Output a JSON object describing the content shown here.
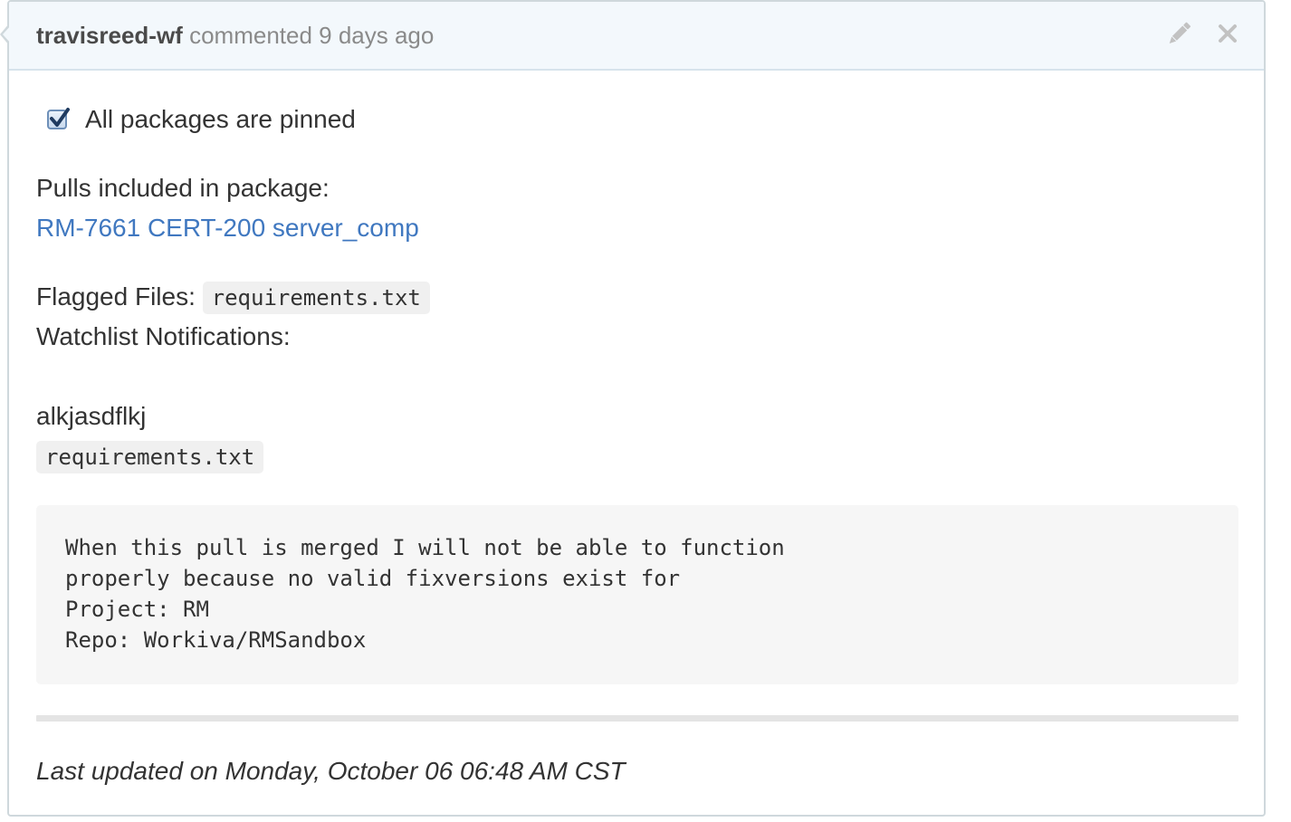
{
  "comment": {
    "author": "travisreed-wf",
    "action_text": "commented 9 days ago",
    "edit_icon": "pencil-icon",
    "close_icon": "close-icon"
  },
  "body": {
    "checkbox_label": "All packages are pinned",
    "checkbox_checked": true,
    "pulls_heading": "Pulls included in package:",
    "pull_link": "RM-7661 CERT-200 server_comp",
    "flagged_label": "Flagged Files:",
    "flagged_file": "requirements.txt",
    "watchlist_label": "Watchlist Notifications:",
    "watch_name": "alkjasdflkj",
    "watch_file": "requirements.txt",
    "message_lines": [
      "When this pull is merged I will not be able to function",
      "properly because no valid fixversions exist for",
      "Project: RM",
      "Repo: Workiva/RMSandbox"
    ],
    "last_updated": "Last updated on Monday, October 06 06:48 AM CST"
  },
  "colors": {
    "link": "#4078c0",
    "header_bg": "#f3f8fc",
    "border": "#cfd8dc"
  }
}
